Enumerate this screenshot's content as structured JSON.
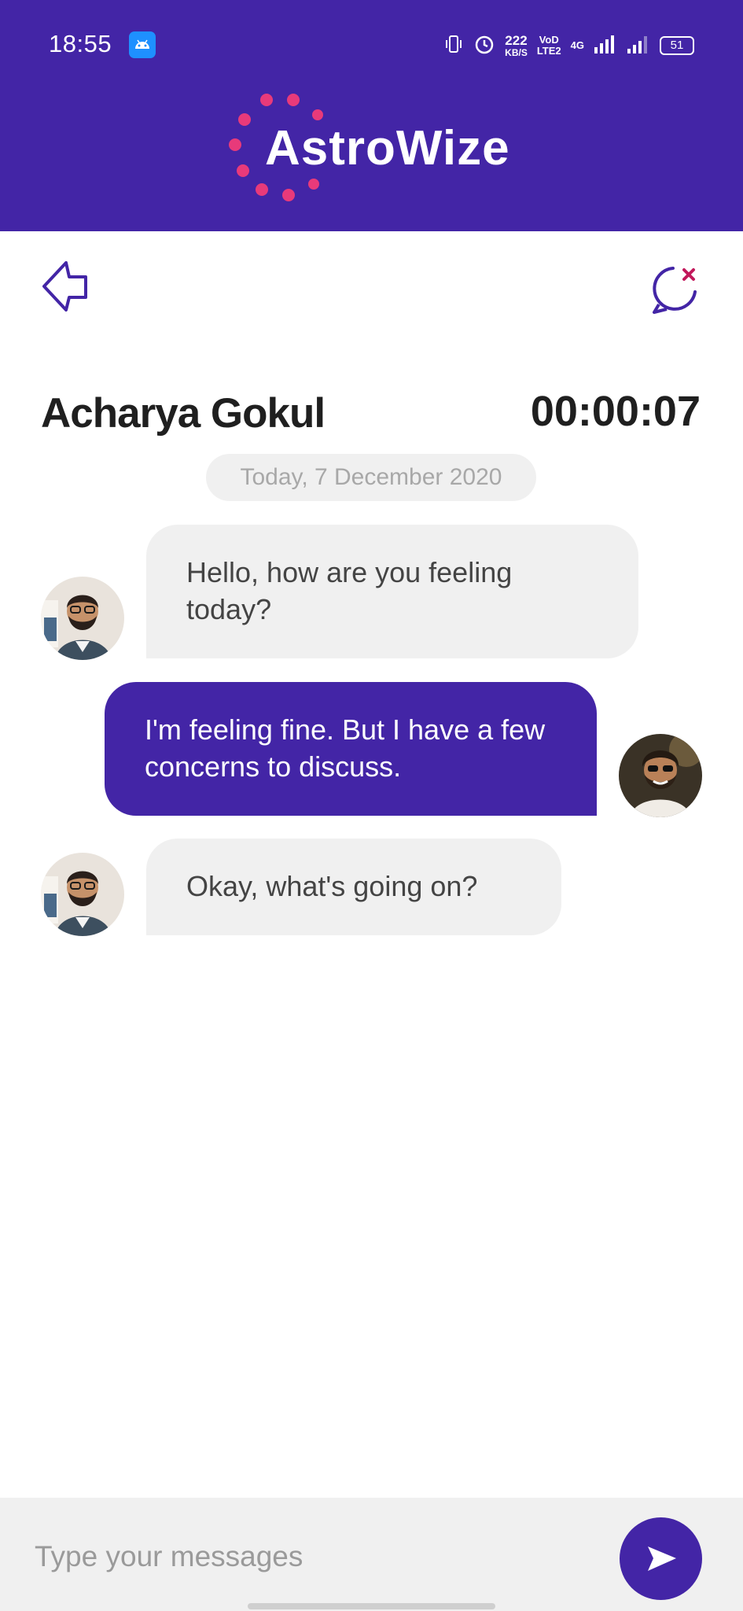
{
  "status_bar": {
    "time": "18:55",
    "net_speed_value": "222",
    "net_speed_unit": "KB/S",
    "volte_top": "VoD",
    "volte_bottom": "LTE2",
    "network_type": "4G",
    "battery": "51"
  },
  "app": {
    "brand": "AstroWize",
    "brand_color": "#4325a6",
    "accent_color": "#e83a7a"
  },
  "chat": {
    "contact_name": "Acharya Gokul",
    "timer": "00:00:07",
    "date_label": "Today, 7 December 2020",
    "messages": [
      {
        "from": "astrologer",
        "text": "Hello, how are you feeling today?"
      },
      {
        "from": "user",
        "text": "I'm feeling fine. But I have a few concerns to discuss."
      },
      {
        "from": "astrologer",
        "text": "Okay, what's going on?"
      }
    ]
  },
  "composer": {
    "placeholder": "Type your messages"
  },
  "icons": {
    "back": "back-arrow-icon",
    "end_chat": "end-chat-icon",
    "send": "send-icon"
  }
}
